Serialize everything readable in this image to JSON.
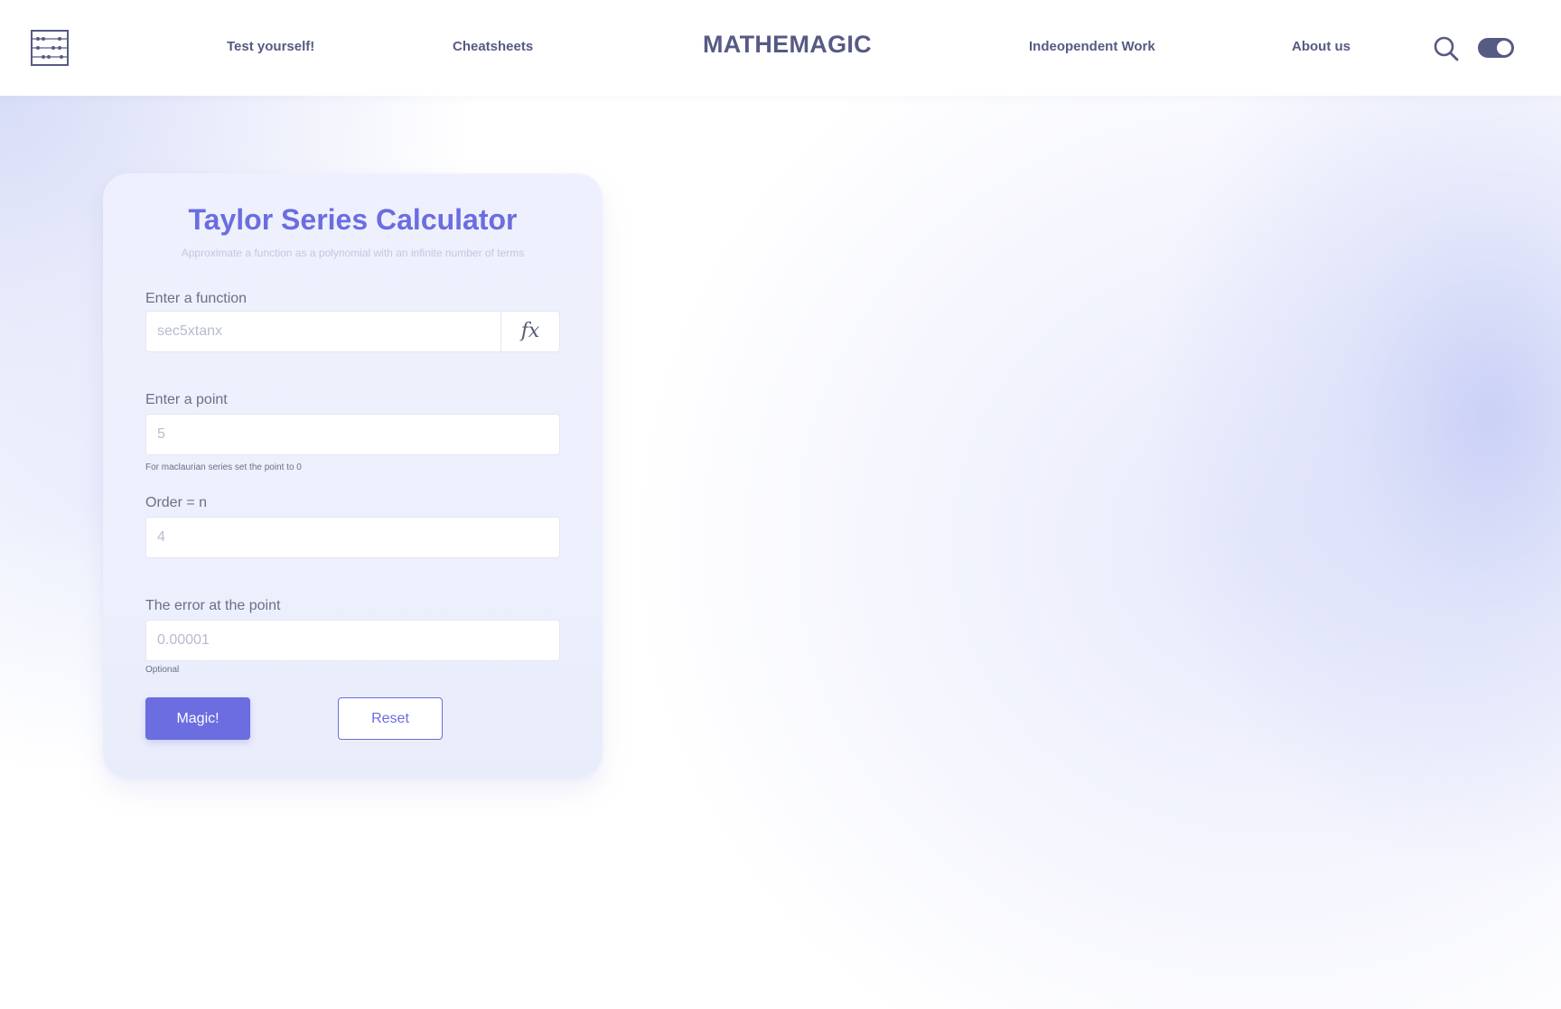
{
  "header": {
    "logo_icon": "abacus-icon",
    "nav": {
      "test_yourself": "Test yourself!",
      "cheatsheets": "Cheatsheets",
      "independent_work": "Indeopendent Work",
      "about_us": "About us"
    },
    "brand": "MATHEMAGIC",
    "search_icon": "search-icon",
    "theme_toggle": {
      "on": true
    }
  },
  "calculator": {
    "title": "Taylor Series Calculator",
    "subtitle": "Approximate a function as a polynomial with an infinite number of terms",
    "function_field": {
      "label": "Enter a function",
      "placeholder": "sec5xtanx",
      "value": "",
      "fx_label": "fx"
    },
    "point_field": {
      "label": "Enter a point",
      "placeholder": "5",
      "value": "",
      "hint": "For maclaurian series set the point to 0"
    },
    "order_field": {
      "label": "Order = n",
      "placeholder": "4",
      "value": ""
    },
    "error_field": {
      "label": "The error at the point",
      "placeholder": "0.00001",
      "value": "",
      "hint": "Optional"
    },
    "buttons": {
      "submit": "Magic!",
      "reset": "Reset"
    }
  },
  "colors": {
    "accent": "#6b6de0",
    "nav_text": "#565a84",
    "label_text": "#6b6f88"
  }
}
